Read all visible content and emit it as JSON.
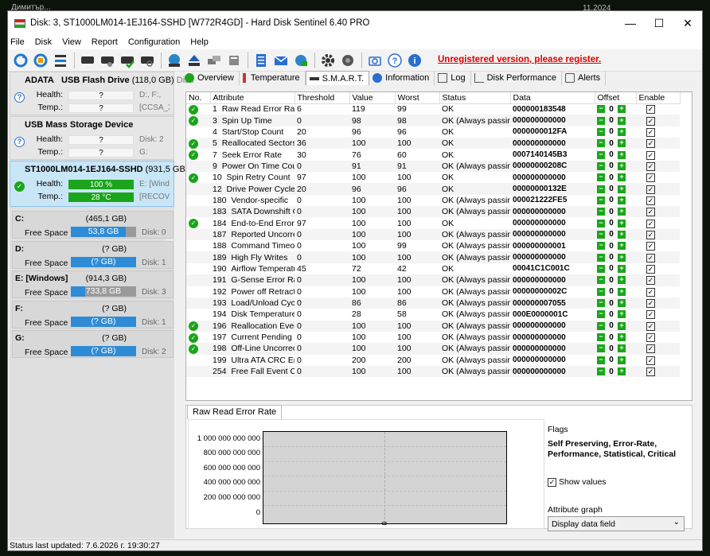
{
  "bg": {
    "user": "Димитър...",
    "date": "11.2024"
  },
  "window": {
    "title": "Disk: 3, ST1000LM014-1EJ164-SSHD [W772R4GD]  -  Hard Disk Sentinel 6.40 PRO",
    "min": "—",
    "max": "☐",
    "close": "✕"
  },
  "menu": [
    "File",
    "Disk",
    "View",
    "Report",
    "Configuration",
    "Help"
  ],
  "toolbar": {
    "unregistered": "Unregistered version, please register."
  },
  "devices": [
    {
      "name": "ADATA",
      "name2": "USB Flash Drive",
      "size": "(118,0 GB)",
      "extra": "Disk",
      "health_label": "Health:",
      "health": "?",
      "health_ext": "D:, F:,",
      "temp_label": "Temp.:",
      "temp": "?",
      "temp_ext": "[CCSA_X"
    },
    {
      "name": "USB Mass Storage Device",
      "health_label": "Health:",
      "health": "?",
      "health_ext": "Disk: 2",
      "temp_label": "Temp.:",
      "temp": "?",
      "temp_ext": "G:"
    },
    {
      "name": "ST1000LM014-1EJ164-SSHD",
      "size": "(931,5 GB)",
      "health_label": "Health:",
      "health": "100 %",
      "health_ext": "E: [Windo",
      "temp_label": "Temp.:",
      "temp": "28 °C",
      "temp_ext": "[RECOVE"
    }
  ],
  "volumes": [
    {
      "name": "C:",
      "size": "(465,1 GB)",
      "free_label": "Free Space",
      "free": "53,8 GB",
      "disk": "Disk: 0"
    },
    {
      "name": "D:",
      "size": "(? GB)",
      "free_label": "Free Space",
      "free": "(? GB)",
      "disk": "Disk: 1"
    },
    {
      "name": "E: [Windows]",
      "size": "(914,3 GB)",
      "free_label": "Free Space",
      "free": "733,8 GB",
      "disk": "Disk: 3"
    },
    {
      "name": "F:",
      "size": "(? GB)",
      "free_label": "Free Space",
      "free": "(? GB)",
      "disk": "Disk: 1"
    },
    {
      "name": "G:",
      "size": "(? GB)",
      "free_label": "Free Space",
      "free": "(? GB)",
      "disk": "Disk: 2"
    }
  ],
  "tabs": [
    "Overview",
    "Temperature",
    "S.M.A.R.T.",
    "Information",
    "Log",
    "Disk Performance",
    "Alerts"
  ],
  "smart": {
    "headers": [
      "No.",
      "Attribute",
      "Threshold",
      "Value",
      "Worst",
      "Status",
      "Data",
      "Offset",
      "Enable"
    ],
    "rows": [
      {
        "ok": true,
        "no": "1",
        "attr": "Raw Read Error Rate",
        "thr": "6",
        "val": "119",
        "worst": "99",
        "status": "OK",
        "data": "000000183548"
      },
      {
        "ok": true,
        "no": "3",
        "attr": "Spin Up Time",
        "thr": "0",
        "val": "98",
        "worst": "98",
        "status": "OK (Always passing)",
        "data": "000000000000"
      },
      {
        "ok": false,
        "no": "4",
        "attr": "Start/Stop Count",
        "thr": "20",
        "val": "96",
        "worst": "96",
        "status": "OK",
        "data": "0000000012FA"
      },
      {
        "ok": true,
        "no": "5",
        "attr": "Reallocated Sectors Co...",
        "thr": "36",
        "val": "100",
        "worst": "100",
        "status": "OK",
        "data": "000000000000"
      },
      {
        "ok": true,
        "no": "7",
        "attr": "Seek Error Rate",
        "thr": "30",
        "val": "76",
        "worst": "60",
        "status": "OK",
        "data": "0007140145B3"
      },
      {
        "ok": false,
        "no": "9",
        "attr": "Power On Time Count",
        "thr": "0",
        "val": "91",
        "worst": "91",
        "status": "OK (Always passing)",
        "data": "00000000208C"
      },
      {
        "ok": true,
        "no": "10",
        "attr": "Spin Retry Count",
        "thr": "97",
        "val": "100",
        "worst": "100",
        "status": "OK",
        "data": "000000000000"
      },
      {
        "ok": false,
        "no": "12",
        "attr": "Drive Power Cycle Count",
        "thr": "20",
        "val": "96",
        "worst": "96",
        "status": "OK",
        "data": "00000000132E"
      },
      {
        "ok": false,
        "no": "180",
        "attr": "Vendor-specific",
        "thr": "0",
        "val": "100",
        "worst": "100",
        "status": "OK (Always passing)",
        "data": "000021222FE5"
      },
      {
        "ok": false,
        "no": "183",
        "attr": "SATA Downshift Count",
        "thr": "0",
        "val": "100",
        "worst": "100",
        "status": "OK (Always passing)",
        "data": "000000000000"
      },
      {
        "ok": true,
        "no": "184",
        "attr": "End-to-End Error Count",
        "thr": "97",
        "val": "100",
        "worst": "100",
        "status": "OK",
        "data": "000000000000"
      },
      {
        "ok": false,
        "no": "187",
        "attr": "Reported Uncorrectabl...",
        "thr": "0",
        "val": "100",
        "worst": "100",
        "status": "OK (Always passing)",
        "data": "000000000000"
      },
      {
        "ok": false,
        "no": "188",
        "attr": "Command Timeout",
        "thr": "0",
        "val": "100",
        "worst": "99",
        "status": "OK (Always passing)",
        "data": "000000000001"
      },
      {
        "ok": false,
        "no": "189",
        "attr": "High Fly Writes",
        "thr": "0",
        "val": "100",
        "worst": "100",
        "status": "OK (Always passing)",
        "data": "000000000000"
      },
      {
        "ok": false,
        "no": "190",
        "attr": "Airflow Temperature",
        "thr": "45",
        "val": "72",
        "worst": "42",
        "status": "OK",
        "data": "00041C1C001C"
      },
      {
        "ok": false,
        "no": "191",
        "attr": "G-Sense Error Rate",
        "thr": "0",
        "val": "100",
        "worst": "100",
        "status": "OK (Always passing)",
        "data": "000000000000"
      },
      {
        "ok": false,
        "no": "192",
        "attr": "Power off Retract Cycle ...",
        "thr": "0",
        "val": "100",
        "worst": "100",
        "status": "OK (Always passing)",
        "data": "00000000002C"
      },
      {
        "ok": false,
        "no": "193",
        "attr": "Load/Unload Cycle Cou...",
        "thr": "0",
        "val": "86",
        "worst": "86",
        "status": "OK (Always passing)",
        "data": "000000007055"
      },
      {
        "ok": false,
        "no": "194",
        "attr": "Disk Temperature",
        "thr": "0",
        "val": "28",
        "worst": "58",
        "status": "OK (Always passing)",
        "data": "000E0000001C"
      },
      {
        "ok": true,
        "no": "196",
        "attr": "Reallocation Event Count",
        "thr": "0",
        "val": "100",
        "worst": "100",
        "status": "OK (Always passing)",
        "data": "000000000000"
      },
      {
        "ok": true,
        "no": "197",
        "attr": "Current Pending Sector...",
        "thr": "0",
        "val": "100",
        "worst": "100",
        "status": "OK (Always passing)",
        "data": "000000000000"
      },
      {
        "ok": true,
        "no": "198",
        "attr": "Off-Line Uncorrectable ...",
        "thr": "0",
        "val": "100",
        "worst": "100",
        "status": "OK (Always passing)",
        "data": "000000000000"
      },
      {
        "ok": false,
        "no": "199",
        "attr": "Ultra ATA CRC Error Co...",
        "thr": "0",
        "val": "200",
        "worst": "200",
        "status": "OK (Always passing)",
        "data": "000000000000"
      },
      {
        "ok": false,
        "no": "254",
        "attr": "Free Fall Event Count",
        "thr": "0",
        "val": "100",
        "worst": "100",
        "status": "OK (Always passing)",
        "data": "000000000000"
      }
    ],
    "offset": "0"
  },
  "graph": {
    "tab": "Raw Read Error Rate",
    "yticks": [
      "1 000 000 000 000",
      "800 000 000 000",
      "600 000 000 000",
      "400 000 000 000",
      "200 000 000 000",
      "0"
    ],
    "xtick": "0"
  },
  "flags": {
    "label": "Flags",
    "text": "Self Preserving, Error-Rate, Performance, Statistical, Critical",
    "show_values": "Show values",
    "attr_graph_label": "Attribute graph",
    "select": "Display data field"
  },
  "status": "Status last updated: 7.6.2026 г. 19:30:27"
}
